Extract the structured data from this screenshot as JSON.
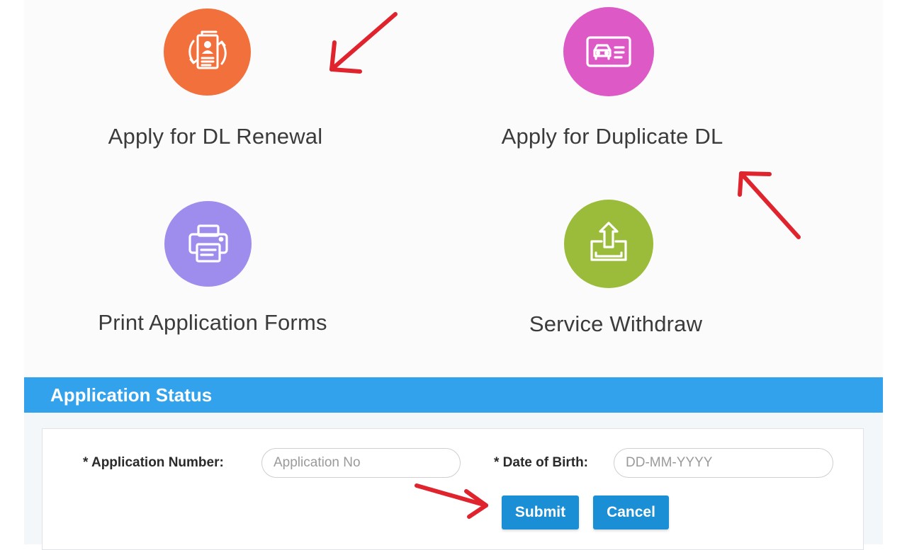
{
  "services": [
    {
      "label": "Apply for DL Renewal",
      "icon": "renewal-document-icon",
      "color": "#f2703c"
    },
    {
      "label": "Apply for Duplicate DL",
      "icon": "driving-license-card-icon",
      "color": "#dc59c6"
    },
    {
      "label": "Print Application Forms",
      "icon": "printer-icon",
      "color": "#9f8ded"
    },
    {
      "label": "Service Withdraw",
      "icon": "upload-tray-icon",
      "color": "#9bbc3a"
    }
  ],
  "status": {
    "title": "Application Status",
    "header_color": "#33a2ed",
    "application_number_label": "* Application Number:",
    "application_number_placeholder": "Application No",
    "dob_label": "* Date of Birth:",
    "dob_placeholder": "DD-MM-YYYY",
    "submit_label": "Submit",
    "cancel_label": "Cancel",
    "button_color": "#1b8fd6"
  },
  "annotation_color": "#e0242e"
}
